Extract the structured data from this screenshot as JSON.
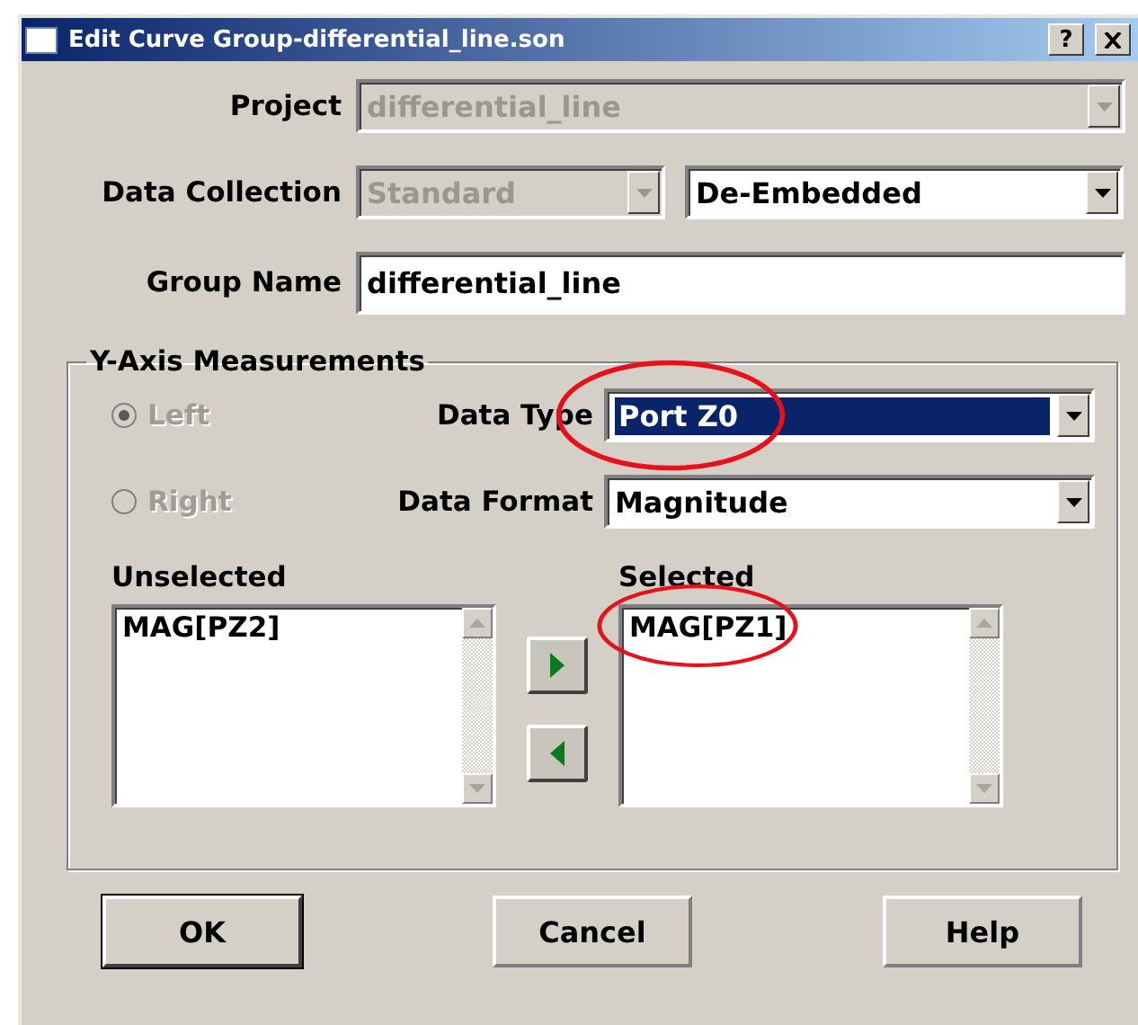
{
  "window": {
    "title": "Edit Curve Group-differential_line.son",
    "help_button": "?"
  },
  "project": {
    "label": "Project",
    "value": "differential_line",
    "disabled": true
  },
  "data_collection": {
    "label": "Data Collection",
    "source": {
      "value": "Standard",
      "disabled": true
    },
    "type": {
      "value": "De-Embedded",
      "disabled": false
    }
  },
  "group_name": {
    "label": "Group Name",
    "value": "differential_line"
  },
  "y_axis": {
    "title": "Y-Axis Measurements",
    "sides": [
      {
        "label": "Left",
        "selected": true,
        "disabled": true
      },
      {
        "label": "Right",
        "selected": false,
        "disabled": true
      }
    ],
    "data_type": {
      "label": "Data Type",
      "value": "Port Z0",
      "focused": true,
      "circled": true
    },
    "data_format": {
      "label": "Data Format",
      "value": "Magnitude",
      "focused": false,
      "circled": false
    },
    "unselected": {
      "label": "Unselected",
      "items": [
        {
          "text": "MAG[PZ2]",
          "circled": false
        }
      ]
    },
    "selected": {
      "label": "Selected",
      "items": [
        {
          "text": "MAG[PZ1]",
          "circled": true
        }
      ]
    }
  },
  "buttons": [
    {
      "label": "OK",
      "default": true
    },
    {
      "label": "Cancel",
      "default": false
    },
    {
      "label": "Help",
      "default": false
    }
  ]
}
